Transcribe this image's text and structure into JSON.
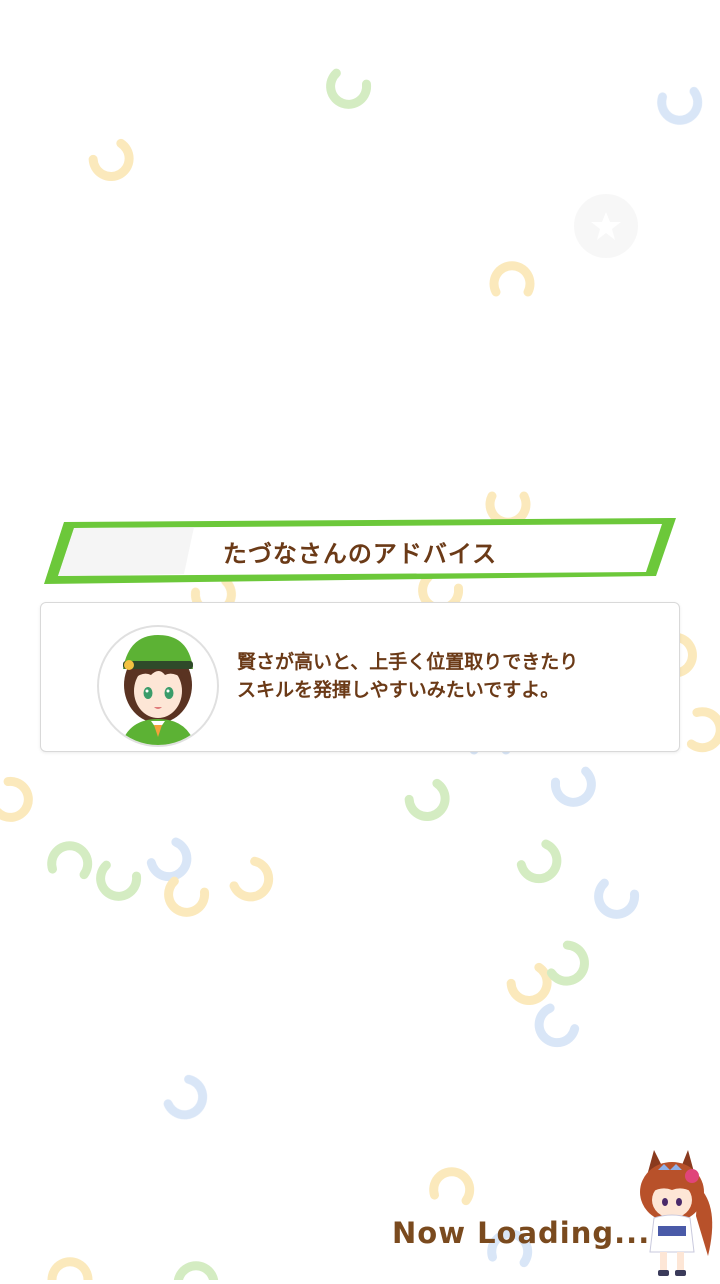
{
  "banner": {
    "title": "たづなさんのアドバイス"
  },
  "advice": {
    "speaker_icon": "tazuna-portrait",
    "text": "賢さが高いと、上手く位置取りできたり\nスキルを発揮しやすいみたいですよ。"
  },
  "loading": {
    "label": "Now Loading..."
  },
  "mascot": {
    "icon": "chibi-horse-girl-icon"
  },
  "colors": {
    "accent_green": "#6cc83a",
    "text_brown": "#6b3a17",
    "shoe_green": "#cde9b8",
    "shoe_yellow": "#fbe6b0",
    "shoe_blue": "#d3e2f6"
  }
}
